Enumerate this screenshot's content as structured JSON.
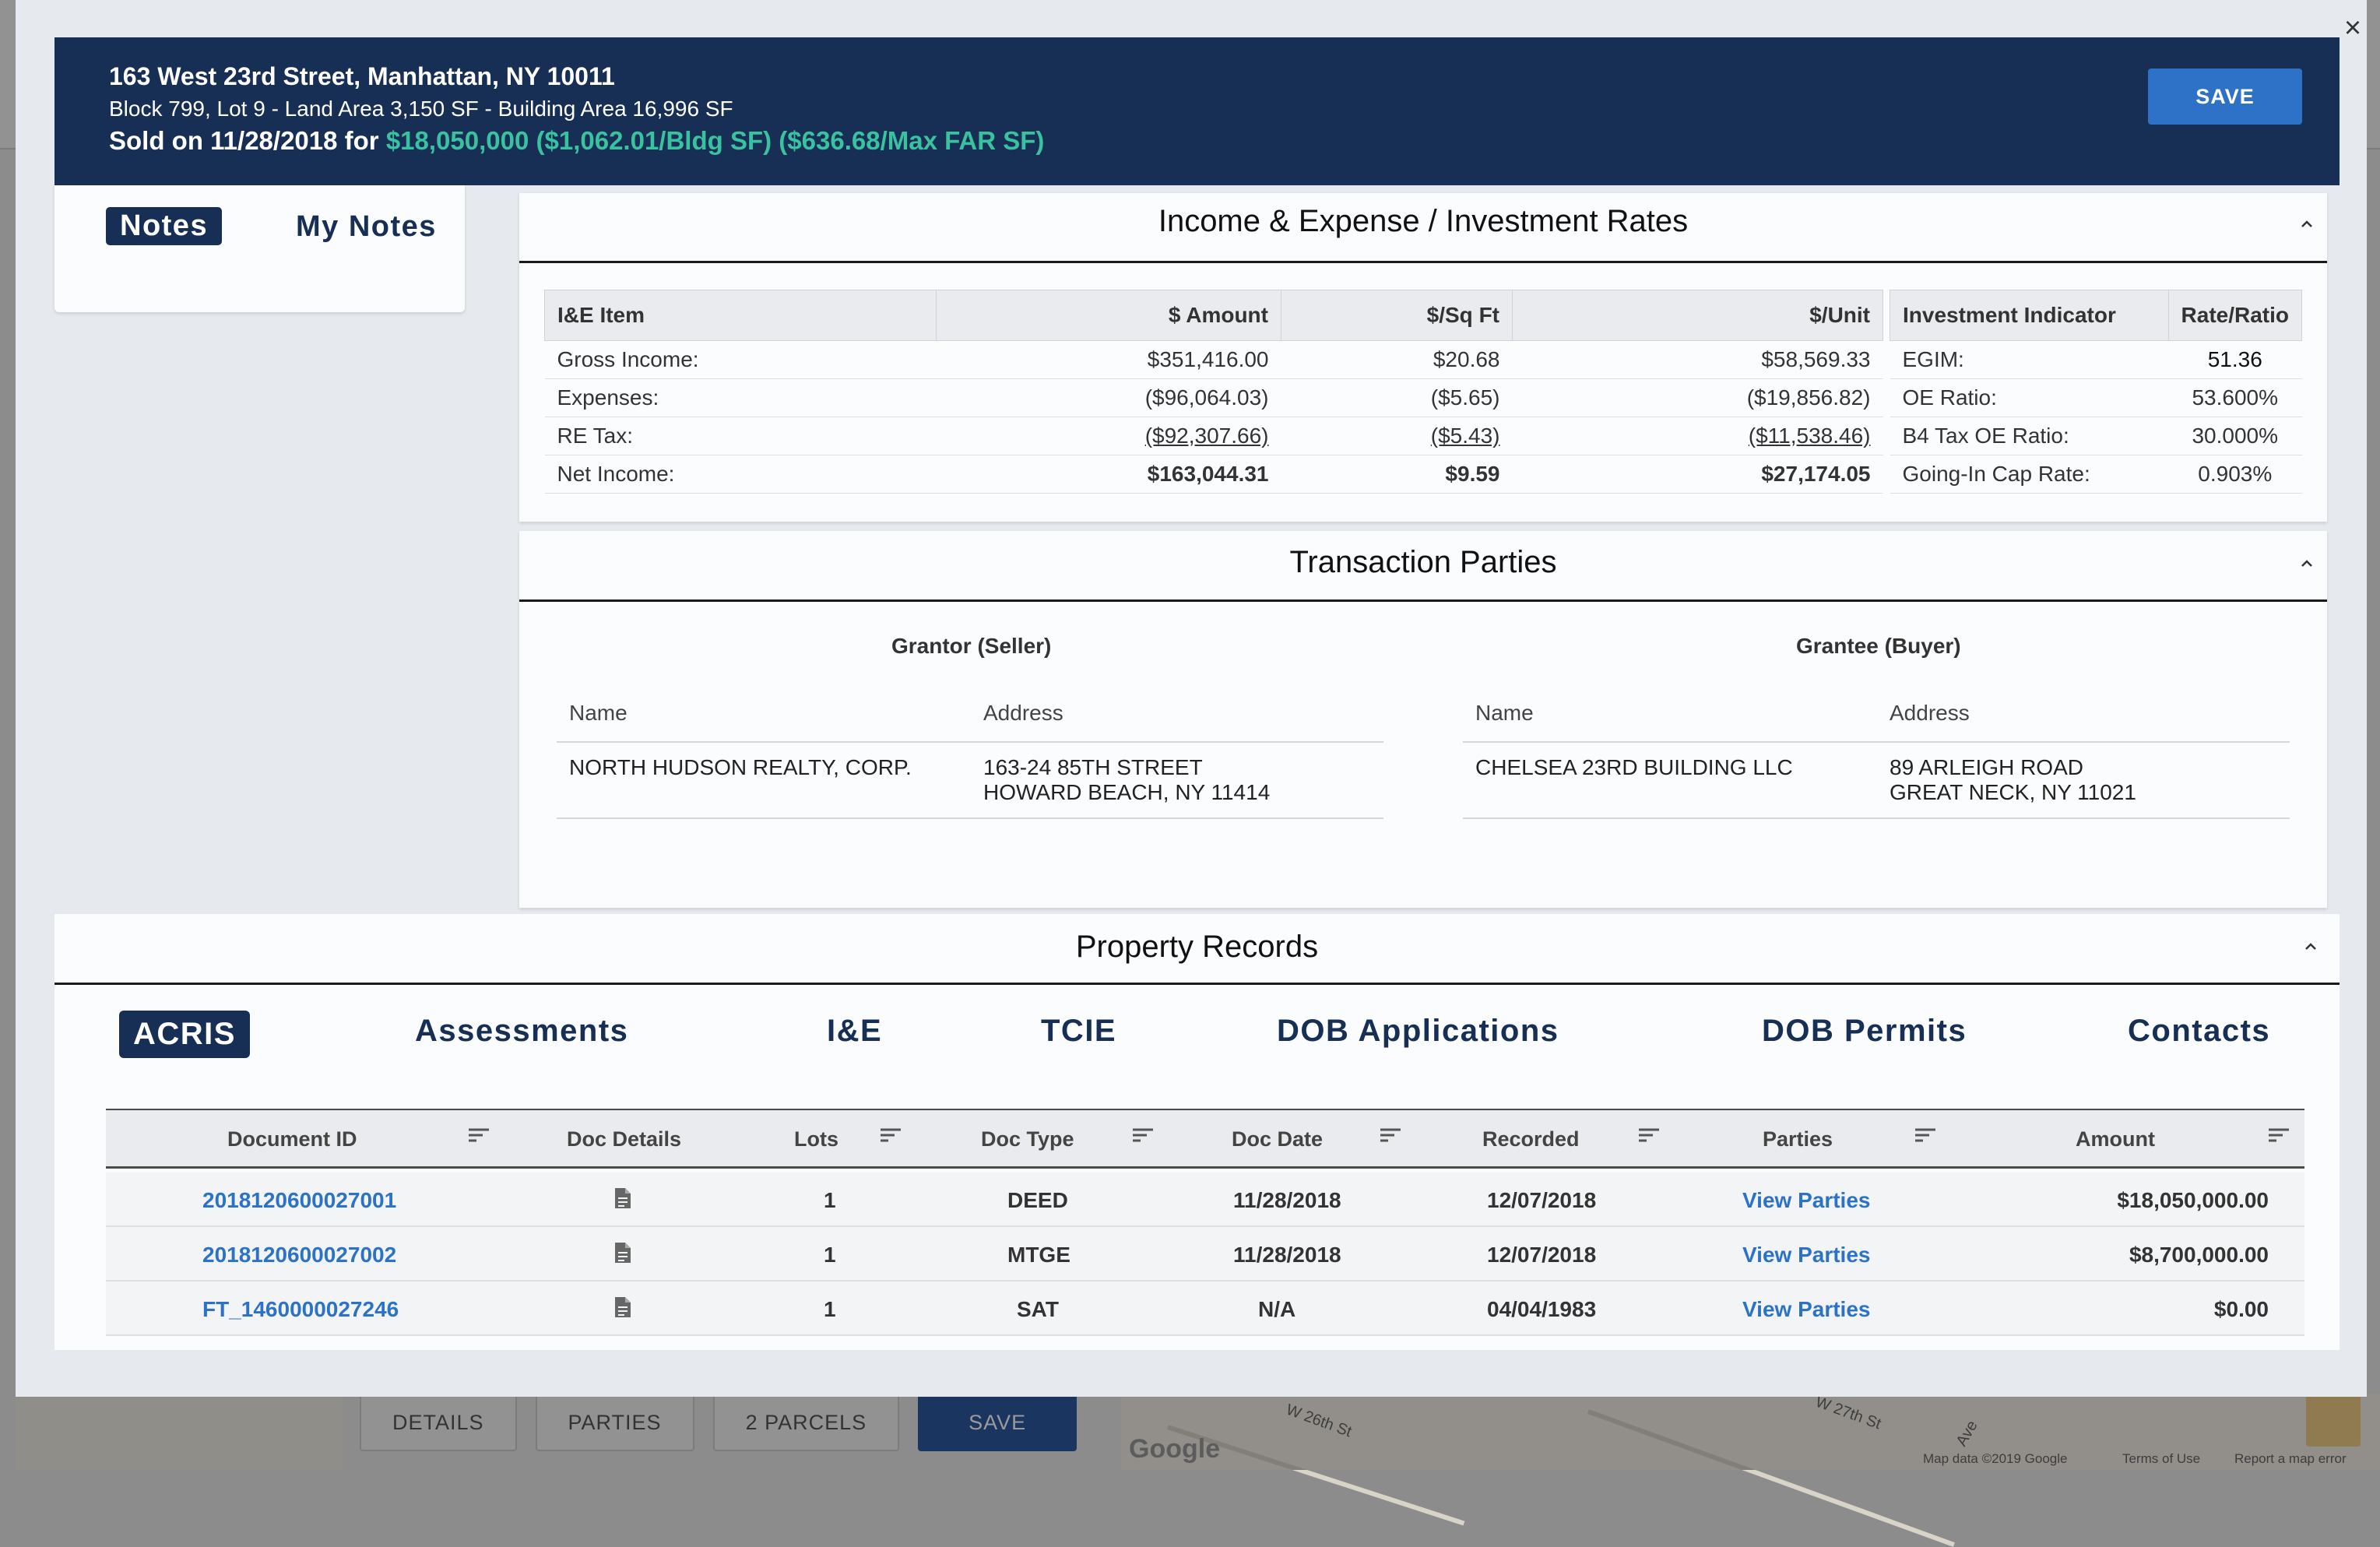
{
  "background": {
    "buttons": [
      "DETAILS",
      "PARTIES",
      "2 PARCELS",
      "SAVE"
    ],
    "map_labels": [
      "W 26th St",
      "W 27th St",
      "Ave",
      "Map data ©2019 Google",
      "Terms of Use",
      "Report a map error"
    ],
    "google_logo": "Google"
  },
  "modal": {
    "close_label": "×",
    "header": {
      "address": "163 West 23rd Street, Manhattan, NY 10011",
      "details": "Block 799, Lot 9 - Land Area 3,150 SF - Building Area 16,996 SF",
      "sold_prefix": "Sold on 11/28/2018 for",
      "sold_values": "$18,050,000 ($1,062.01/Bldg SF) ($636.68/Max FAR SF)",
      "save_label": "SAVE"
    },
    "notes": {
      "tab_notes": "Notes",
      "tab_my_notes": "My Notes"
    },
    "income_expense": {
      "title": "Income & Expense / Investment Rates",
      "columns": [
        "I&E Item",
        "$ Amount",
        "$/Sq Ft",
        "$/Unit"
      ],
      "rows": [
        {
          "item": "Gross Income:",
          "amount": "$351,416.00",
          "sqft": "$20.68",
          "unit": "$58,569.33"
        },
        {
          "item": "Expenses:",
          "amount": "($96,064.03)",
          "sqft": "($5.65)",
          "unit": "($19,856.82)"
        },
        {
          "item": "RE Tax:",
          "amount": "($92,307.66)",
          "sqft": "($5.43)",
          "unit": "($11,538.46)"
        },
        {
          "item": "Net Income:",
          "amount": "$163,044.31",
          "sqft": "$9.59",
          "unit": "$27,174.05"
        }
      ],
      "investment_columns": [
        "Investment Indicator",
        "Rate/Ratio"
      ],
      "investment_rows": [
        {
          "indicator": "EGIM:",
          "value": "51.36"
        },
        {
          "indicator": "OE Ratio:",
          "value": "53.600%"
        },
        {
          "indicator": "B4 Tax OE Ratio:",
          "value": "30.000%"
        },
        {
          "indicator": "Going-In Cap Rate:",
          "value": "0.903%"
        }
      ]
    },
    "transaction_parties": {
      "title": "Transaction Parties",
      "grantor_heading": "Grantor (Seller)",
      "grantee_heading": "Grantee (Buyer)",
      "name_label": "Name",
      "address_label": "Address",
      "grantor": {
        "name": "NORTH HUDSON REALTY, CORP.",
        "address_line1": "163-24 85TH STREET",
        "address_line2": "HOWARD BEACH, NY 11414"
      },
      "grantee": {
        "name": "CHELSEA 23RD BUILDING LLC",
        "address_line1": "89 ARLEIGH ROAD",
        "address_line2": "GREAT NECK, NY 11021"
      }
    },
    "property_records": {
      "title": "Property Records",
      "tabs": [
        "ACRIS",
        "Assessments",
        "I&E",
        "TCIE",
        "DOB Applications",
        "DOB Permits",
        "Contacts"
      ],
      "active_tab": "ACRIS",
      "columns": [
        "Document ID",
        "Doc Details",
        "Lots",
        "Doc Type",
        "Doc Date",
        "Recorded",
        "Parties",
        "Amount"
      ],
      "rows": [
        {
          "doc_id": "2018120600027001",
          "lots": "1",
          "doc_type": "DEED",
          "doc_date": "11/28/2018",
          "recorded": "12/07/2018",
          "parties": "View Parties",
          "amount": "$18,050,000.00"
        },
        {
          "doc_id": "2018120600027002",
          "lots": "1",
          "doc_type": "MTGE",
          "doc_date": "11/28/2018",
          "recorded": "12/07/2018",
          "parties": "View Parties",
          "amount": "$8,700,000.00"
        },
        {
          "doc_id": "FT_1460000027246",
          "lots": "1",
          "doc_type": "SAT",
          "doc_date": "N/A",
          "recorded": "04/04/1983",
          "parties": "View Parties",
          "amount": "$0.00"
        }
      ]
    }
  },
  "colors": {
    "header_navy": "#172f55",
    "accent_blue": "#2d72c7",
    "positive_green": "#3aa889",
    "negative_red": "#cc2c2c",
    "link_blue": "#2c72c7"
  },
  "icons": [
    "close-icon",
    "chevron-up-icon",
    "sort-icon",
    "document-icon"
  ]
}
